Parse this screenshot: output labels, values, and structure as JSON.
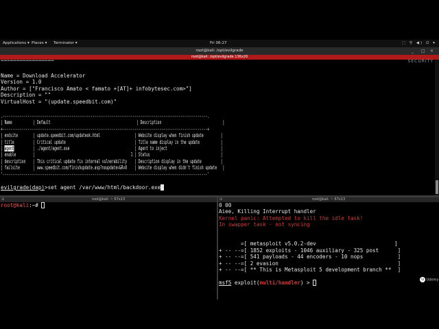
{
  "gnome": {
    "applications": "Applications ▾",
    "places": "Places ▾",
    "terminator": "Terminator ▾",
    "clock": "Fri 06:27",
    "tray": "⬚ ⚲ ◀) ⏻ ▾"
  },
  "window": {
    "title": "root@kali: /opt/evilgrade",
    "tab_title": "root@kali: /opt/evilgrade 136x20",
    "controls": [
      "_",
      "□",
      "×"
    ]
  },
  "watermark": "SECURITY",
  "top_pane": {
    "divider_line": "=================",
    "name": "Name = Download Accelerator",
    "version": "Version = 1.0",
    "author": "Author = [\"Francisco Amato < famato +[AT]+ infobytesec.com>\"]",
    "description": "Description = \"\"",
    "vhost": "VirtualHost = \"(update.speedbit.com)\"",
    "table_border_top": ".-----------------------------------------------------------------------------------------------------------.",
    "table_header": "| Name           | Default                                             | Description                                |",
    "table_border_mid": "+-----------------------------------------------------------------------------------------------------------+",
    "rows": [
      {
        "pre": "| endsite        | ",
        "val": "update.speedbit.com/updateok.html                  ",
        "desc": "| Website display when finish update         |"
      },
      {
        "pre": "| title          | ",
        "val": "Critical update                                    ",
        "desc": "| Title name display in the update           |"
      },
      {
        "pre": "| ",
        "hl": "agent",
        "pre2": "          | ",
        "val": "./agent/agent.exe                                  ",
        "desc": "| Agent to inject                            |"
      },
      {
        "pre": "| enable         | ",
        "val": "                                                 1 ",
        "desc": "| Status                                     |"
      },
      {
        "pre": "| description    | ",
        "val": "This critical update fix internal vulnerability    ",
        "desc": "| Description display in the update          |"
      },
      {
        "pre": "| failsite       | ",
        "val": "www.speedbit.com/finishupdate.asp?noupdate=&R=0    ",
        "desc": "| Website display when didn't finish update   |"
      }
    ],
    "table_border_bot": "'-----------------------------------------------------------------------------------------------------------'",
    "prompt": "evilgrade(dap)",
    "command": ">set agent /var/www/html/backdoor.exe"
  },
  "left_pane": {
    "header": "root@kali: ~ 67x13",
    "index": "⊞",
    "prompt": "root@kali",
    "path": ":~# "
  },
  "right_pane": {
    "header": "root@kali: ~ 67x13",
    "index": "⊞",
    "lines": [
      {
        "t": "0 00",
        "c": ""
      },
      {
        "t": "Aiee, Killing Interrupt handler",
        "c": ""
      },
      {
        "t": "Kernel panic: Attempted to kill the idle task!",
        "c": "red"
      },
      {
        "t": "In swapper task - not syncing",
        "c": "red"
      },
      {
        "t": "",
        "c": ""
      },
      {
        "t": "",
        "c": ""
      },
      {
        "t": "       =[ metasploit v5.0.2-dev                         ]",
        "c": ""
      },
      {
        "t": "+ -- --=[ 1852 exploits - 1046 auxiliary - 325 post      ]",
        "c": ""
      },
      {
        "t": "+ -- --=[ 541 payloads - 44 encoders - 10 nops           ]",
        "c": ""
      },
      {
        "t": "+ -- --=[ 2 evasion                                      ]",
        "c": ""
      },
      {
        "t": "+ -- --=[ ** This is Metasploit 5 development branch **  ]",
        "c": ""
      },
      {
        "t": "",
        "c": ""
      }
    ],
    "msf": "msf5",
    "exploit_pre": " exploit(",
    "module": "multi/handler",
    "exploit_post": ") > "
  },
  "udemy": "Udemy"
}
